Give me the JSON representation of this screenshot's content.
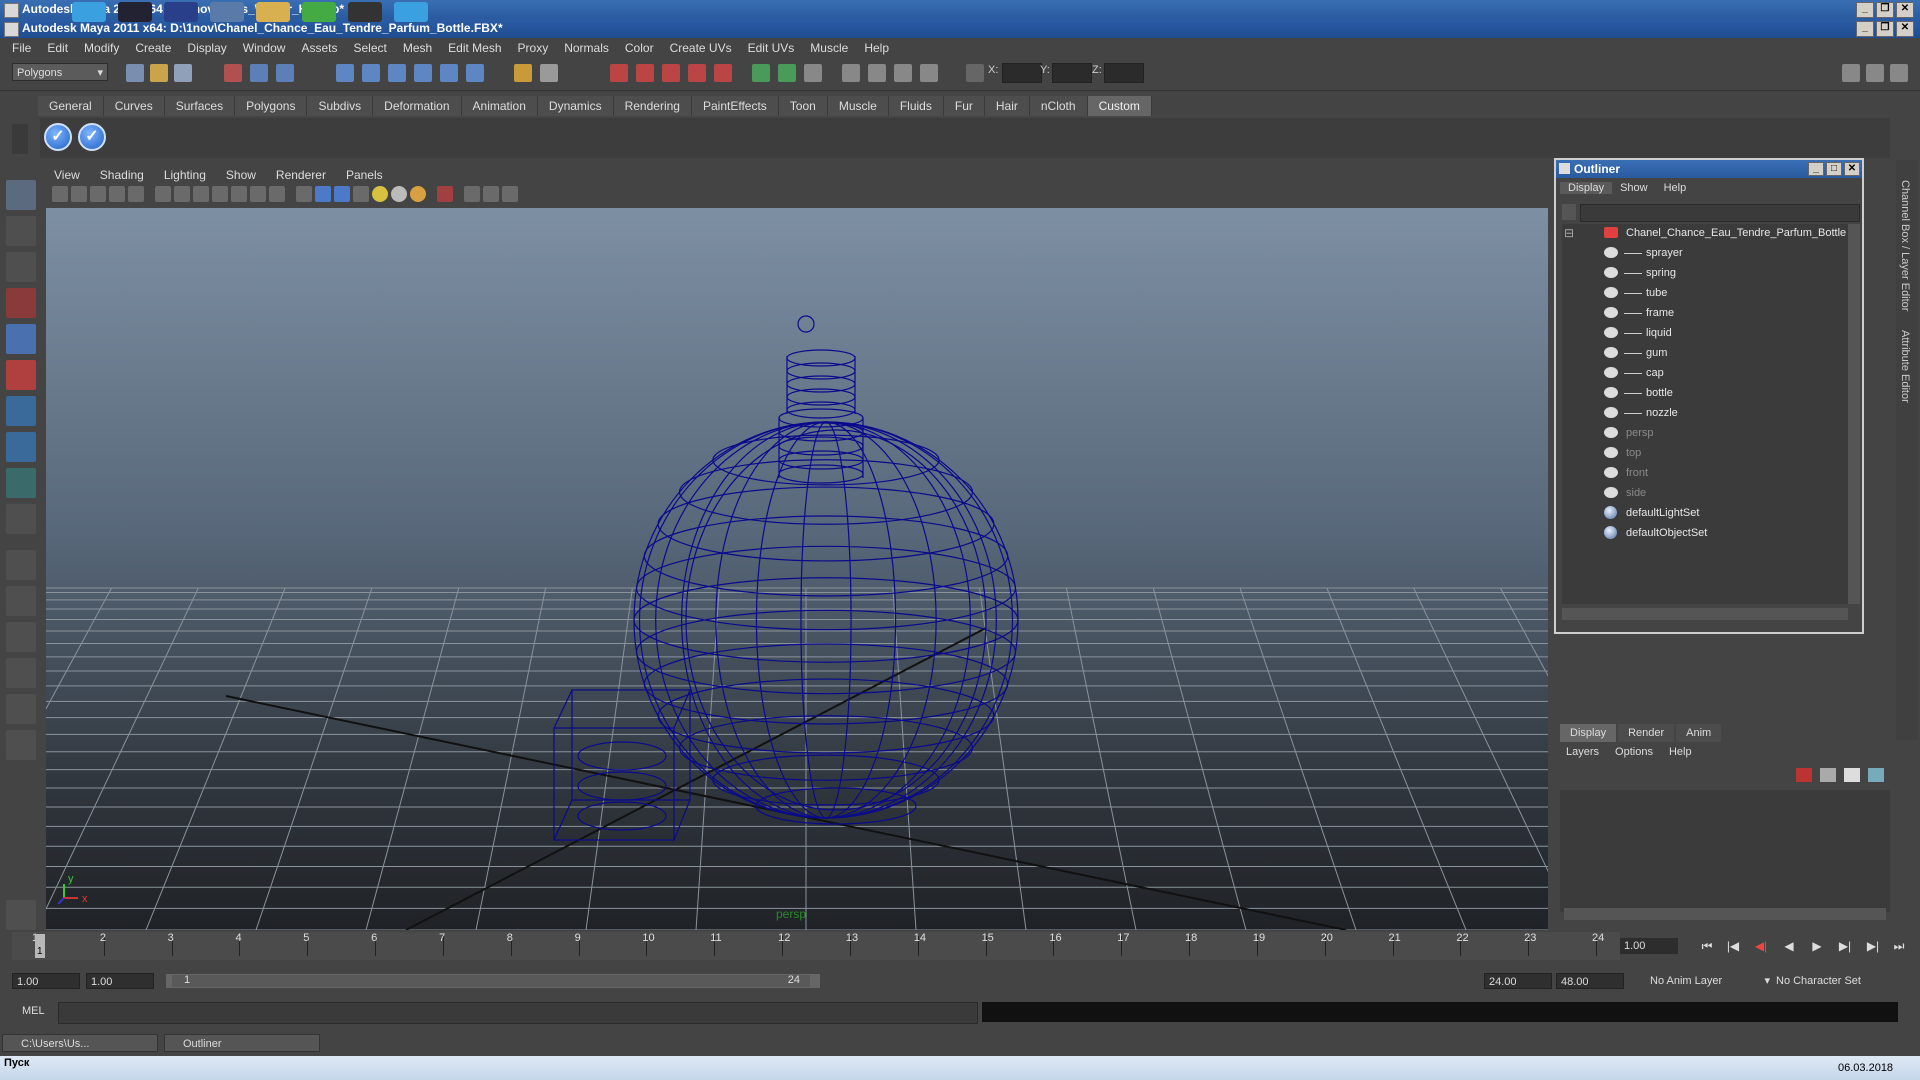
{
  "window": {
    "title_back": "Autodesk Maya 2011 x64: D:\\1nov\\Mens_Winter_Hat.mb*",
    "title_front": "Autodesk Maya 2011 x64: D:\\1nov\\Chanel_Chance_Eau_Tendre_Parfum_Bottle.FBX*"
  },
  "menubar": [
    "File",
    "Edit",
    "Modify",
    "Create",
    "Display",
    "Window",
    "Assets",
    "Select",
    "Mesh",
    "Edit Mesh",
    "Proxy",
    "Normals",
    "Color",
    "Create UVs",
    "Edit UVs",
    "Muscle",
    "Help"
  ],
  "status_line": {
    "mode": "Polygons",
    "x_label": "X:",
    "y_label": "Y:",
    "z_label": "Z:"
  },
  "shelf": {
    "tabs": [
      "General",
      "Curves",
      "Surfaces",
      "Polygons",
      "Subdivs",
      "Deformation",
      "Animation",
      "Dynamics",
      "Rendering",
      "PaintEffects",
      "Toon",
      "Muscle",
      "Fluids",
      "Fur",
      "Hair",
      "nCloth",
      "Custom"
    ],
    "active_tab": "Custom"
  },
  "viewport": {
    "menu": [
      "View",
      "Shading",
      "Lighting",
      "Show",
      "Renderer",
      "Panels"
    ],
    "camera_label": "persp",
    "axis_x": "x",
    "axis_y": "y",
    "wire_color": "#0a0a8c"
  },
  "outliner": {
    "title": "Outliner",
    "menu": [
      "Display",
      "Show",
      "Help"
    ],
    "root": "Chanel_Chance_Eau_Tendre_Parfum_Bottle",
    "children": [
      "sprayer",
      "spring",
      "tube",
      "frame",
      "liquid",
      "gum",
      "cap",
      "bottle",
      "nozzle"
    ],
    "cameras": [
      "persp",
      "top",
      "front",
      "side"
    ],
    "sets": [
      "defaultLightSet",
      "defaultObjectSet"
    ]
  },
  "side_panel": {
    "channel_box_label": "Channel Box / Layer Editor",
    "attribute_editor_label": "Attribute Editor"
  },
  "layer_editor": {
    "tabs": [
      "Display",
      "Render",
      "Anim"
    ],
    "active_tab": "Display",
    "menu": [
      "Layers",
      "Options",
      "Help"
    ]
  },
  "time_slider": {
    "ticks": [
      "1",
      "2",
      "3",
      "4",
      "5",
      "6",
      "7",
      "8",
      "9",
      "10",
      "11",
      "12",
      "13",
      "14",
      "15",
      "16",
      "17",
      "18",
      "19",
      "20",
      "21",
      "22",
      "23",
      "24"
    ],
    "current_frame": "1.00",
    "current_marker": "1"
  },
  "range_slider": {
    "start": "1.00",
    "playback_start": "1.00",
    "slider_start": "1",
    "slider_end": "24",
    "playback_end": "24.00",
    "end": "48.00",
    "anim_layer": "No Anim Layer",
    "character_set": "No Character Set"
  },
  "command_line": {
    "label": "MEL"
  },
  "minimized": {
    "win1": "C:\\Users\\Us...",
    "win2": "Outliner"
  },
  "taskbar": {
    "start": "Пуск",
    "date": "06.03.2018"
  }
}
